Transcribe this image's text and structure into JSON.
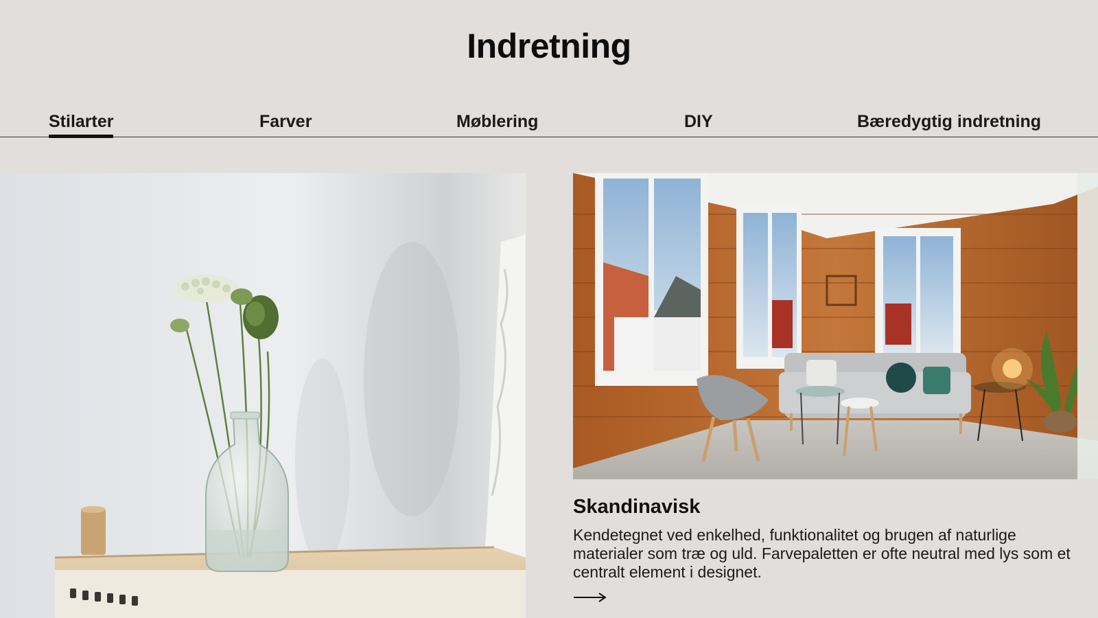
{
  "page": {
    "title": "Indretning"
  },
  "tabs": [
    {
      "label": "Stilarter",
      "active": true
    },
    {
      "label": "Farver",
      "active": false
    },
    {
      "label": "Møblering",
      "active": false
    },
    {
      "label": "DIY",
      "active": false
    },
    {
      "label": "Bæredygtig indretning",
      "active": false
    }
  ],
  "card": {
    "title": "Skandinavisk",
    "description": "Kendetegnet ved enkelhed, funktionalitet og brugen af naturlige materialer som træ og uld. Farvepaletten er ofte neutral med lys som et centralt element i designet.",
    "arrow_icon": "arrow-right-icon"
  },
  "colors": {
    "background": "#e2dedb",
    "text": "#111111",
    "wood": "#b8692c"
  }
}
